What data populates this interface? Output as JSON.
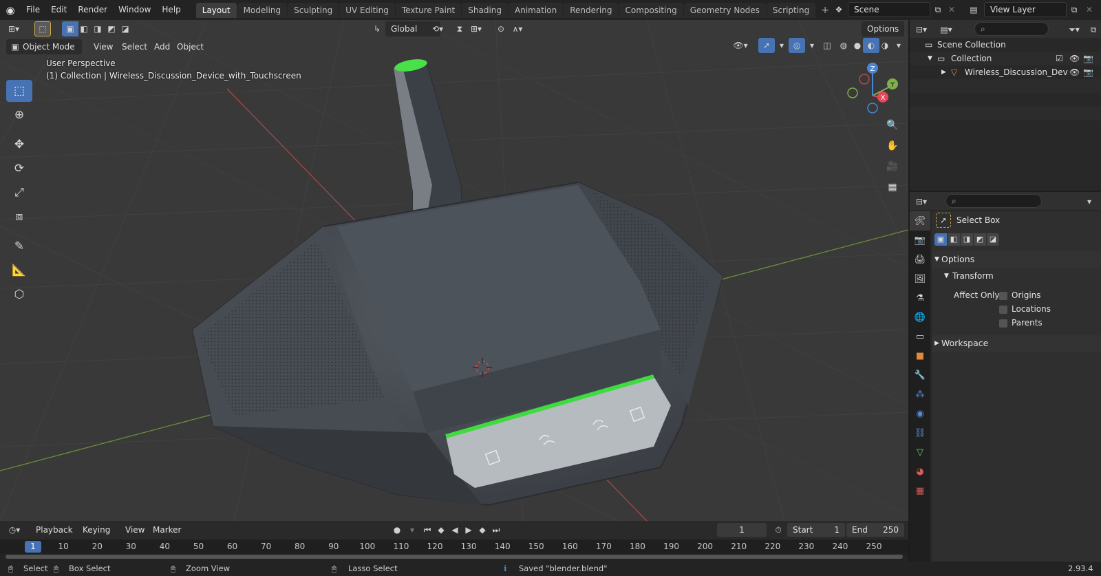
{
  "app": {
    "menus": [
      "File",
      "Edit",
      "Render",
      "Window",
      "Help"
    ],
    "workspaces": [
      "Layout",
      "Modeling",
      "Sculpting",
      "UV Editing",
      "Texture Paint",
      "Shading",
      "Animation",
      "Rendering",
      "Compositing",
      "Geometry Nodes",
      "Scripting"
    ],
    "active_workspace": "Layout",
    "scene": "Scene",
    "view_layer": "View Layer"
  },
  "viewport": {
    "mode": "Object Mode",
    "menus": [
      "View",
      "Select",
      "Add",
      "Object"
    ],
    "orientation": "Global",
    "options": "Options",
    "perspective": "User Perspective",
    "collection_info": "(1) Collection | Wireless_Discussion_Device_with_Touchscreen",
    "gizmo": {
      "z": "Z",
      "y": "Y",
      "x": "X"
    }
  },
  "outliner": {
    "scene_collection": "Scene Collection",
    "collection": "Collection",
    "object": "Wireless_Discussion_Dev"
  },
  "properties": {
    "tool_name": "Select Box",
    "options_label": "Options",
    "transform_label": "Transform",
    "affect_only": "Affect Only",
    "checks": [
      "Origins",
      "Locations",
      "Parents"
    ],
    "workspace_label": "Workspace"
  },
  "timeline": {
    "menus": [
      "Playback",
      "Keying",
      "View",
      "Marker"
    ],
    "current_frame": "1",
    "start_label": "Start",
    "start": "1",
    "end_label": "End",
    "end": "250",
    "ticks": [
      "1",
      "10",
      "20",
      "30",
      "40",
      "50",
      "60",
      "70",
      "80",
      "90",
      "100",
      "110",
      "120",
      "130",
      "140",
      "150",
      "160",
      "170",
      "180",
      "190",
      "200",
      "210",
      "220",
      "230",
      "240",
      "250"
    ]
  },
  "status": {
    "select": "Select",
    "box_select": "Box Select",
    "zoom_view": "Zoom View",
    "lasso_select": "Lasso Select",
    "message": "Saved \"blender.blend\"",
    "version": "2.93.4"
  },
  "colors": {
    "accent": "#4772b3",
    "device_body": "#4b5058",
    "device_light": "#3fdb3f",
    "grid_line": "#434343",
    "x_axis": "#a14a4a",
    "y_axis": "#6b8f3a"
  }
}
